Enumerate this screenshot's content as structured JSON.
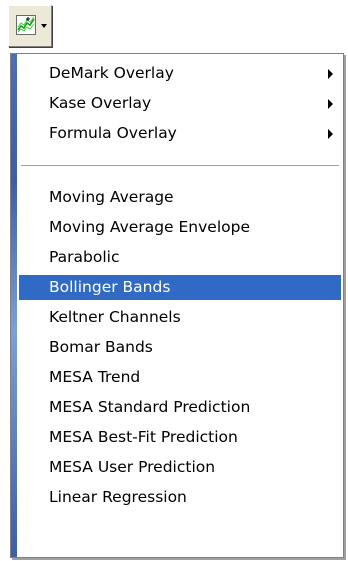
{
  "toolbar": {
    "button_icon": "indicator-chart-icon",
    "dropdown_icon": "dropdown-arrow-icon"
  },
  "menu": {
    "submenus": [
      {
        "label": "DeMark Overlay",
        "icon": "submenu-arrow-icon"
      },
      {
        "label": "Kase Overlay",
        "icon": "submenu-arrow-icon"
      },
      {
        "label": "Formula Overlay",
        "icon": "submenu-arrow-icon"
      }
    ],
    "items": [
      {
        "label": "Moving Average"
      },
      {
        "label": "Moving Average Envelope"
      },
      {
        "label": "Parabolic"
      },
      {
        "label": "Bollinger Bands",
        "selected": true
      },
      {
        "label": "Keltner Channels"
      },
      {
        "label": "Bomar Bands"
      },
      {
        "label": "MESA Trend"
      },
      {
        "label": "MESA Standard Prediction"
      },
      {
        "label": "MESA Best-Fit Prediction"
      },
      {
        "label": "MESA User Prediction"
      },
      {
        "label": "Linear Regression"
      }
    ]
  },
  "colors": {
    "selection": "#316ac5",
    "selection_text": "#ffffff",
    "menu_background": "#ffffff",
    "button_face": "#ece9d8"
  }
}
